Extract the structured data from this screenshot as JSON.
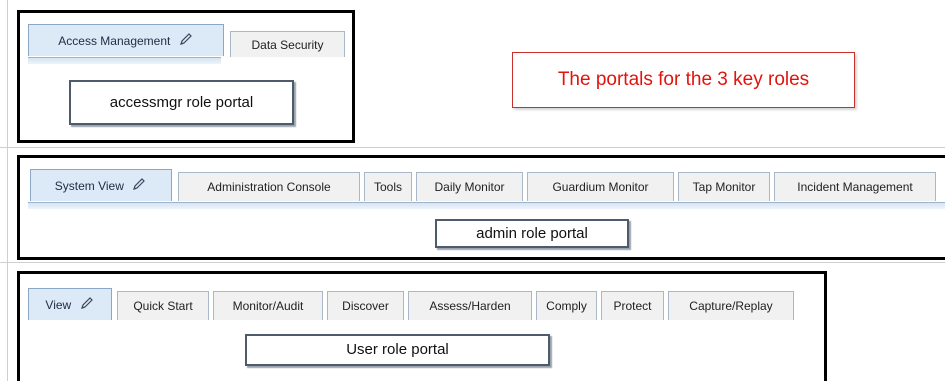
{
  "callout": {
    "text": "The portals for the 3 key roles"
  },
  "portal_access": {
    "tabs": [
      {
        "label": "Access Management",
        "active": true,
        "editable": true
      },
      {
        "label": "Data Security",
        "active": false
      }
    ],
    "portal_label": "accessmgr role portal"
  },
  "portal_admin": {
    "tabs": [
      {
        "label": "System View",
        "active": true,
        "editable": true
      },
      {
        "label": "Administration Console",
        "active": false
      },
      {
        "label": "Tools",
        "active": false
      },
      {
        "label": "Daily Monitor",
        "active": false
      },
      {
        "label": "Guardium Monitor",
        "active": false
      },
      {
        "label": "Tap Monitor",
        "active": false
      },
      {
        "label": "Incident Management",
        "active": false
      }
    ],
    "portal_label": "admin role portal"
  },
  "portal_user": {
    "tabs": [
      {
        "label": "View",
        "active": true,
        "editable": true
      },
      {
        "label": "Quick Start",
        "active": false
      },
      {
        "label": "Monitor/Audit",
        "active": false
      },
      {
        "label": "Discover",
        "active": false
      },
      {
        "label": "Assess/Harden",
        "active": false
      },
      {
        "label": "Comply",
        "active": false
      },
      {
        "label": "Protect",
        "active": false
      },
      {
        "label": "Capture/Replay",
        "active": false
      }
    ],
    "portal_label": "User role portal"
  },
  "icons": {
    "edit": "pencil-icon"
  }
}
